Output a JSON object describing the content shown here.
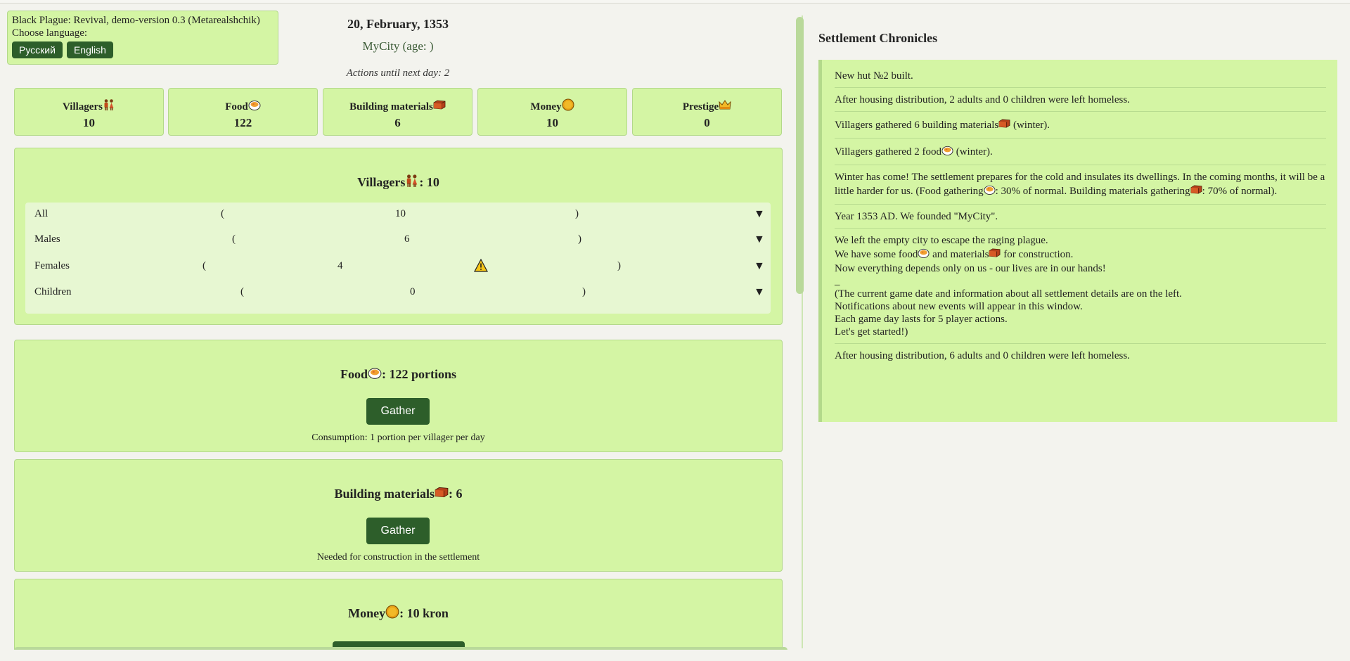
{
  "header": {
    "game_title": "Black Plague: Revival, demo-version 0.3 (Metarealshchik)",
    "choose_language": "Choose language:",
    "lang_ru": "Русский",
    "lang_en": "English",
    "date": "20, February, 1353",
    "city": "MyCity (age: )",
    "actions_until_next_day": "Actions until next day: 2"
  },
  "stats": [
    {
      "label": "Villagers",
      "icon": "villagers-icon",
      "value": "10"
    },
    {
      "label": "Food",
      "icon": "food-icon",
      "value": "122"
    },
    {
      "label": "Building materials",
      "icon": "bricks-icon",
      "value": "6"
    },
    {
      "label": "Money",
      "icon": "coin-icon",
      "value": "10"
    },
    {
      "label": "Prestige",
      "icon": "crown-icon",
      "value": "0"
    }
  ],
  "villagers_card": {
    "title": "Villagers",
    "title_value": ": 10",
    "rows": [
      {
        "label": "All",
        "open": "(",
        "value": "10",
        "close": ")",
        "arrow": "▼"
      },
      {
        "label": "Males",
        "open": "(",
        "value": "6",
        "close": ")",
        "arrow": "▼"
      },
      {
        "label": "Females",
        "open": "(",
        "value": "4",
        "close": ")",
        "arrow": "▼"
      },
      {
        "label": "Children",
        "open": "(",
        "value": "0",
        "close": ")",
        "arrow": "▼"
      }
    ]
  },
  "food_card": {
    "title": "Food",
    "title_value": ": 122 portions",
    "button": "Gather",
    "note": "Consumption: 1 portion per villager per day"
  },
  "materials_card": {
    "title": "Building materials",
    "title_value": ": 6",
    "button": "Gather",
    "note": "Needed for construction in the settlement"
  },
  "money_card": {
    "title": "Money",
    "title_value": ": 10 kron"
  },
  "chronicles": {
    "title": "Settlement Chronicles",
    "entries": [
      "New hut №2 built.",
      "After housing distribution, 2 adults and 0 children were left homeless.",
      "Villagers gathered 6 building materials{bricks} (winter).",
      "Villagers gathered 2 food{food} (winter).",
      "Winter has come! The settlement prepares for the cold and insulates its dwellings. In the coming months, it will be a little harder for us. (Food gathering{food}: 30% of normal. Building materials gathering{bricks}: 70% of normal).",
      "Year 1353 AD. We founded \"MyCity\".",
      "We left the empty city to escape the raging plague.\nWe have some food{food} and materials{bricks} for construction.\nNow everything depends only on us - our lives are in our hands!\n_\n(The current game date and information about all settlement details are on the left.\nNotifications about new events will appear in this window.\nEach game day lasts for 5 player actions.\nLet's get started!)",
      "After housing distribution, 6 adults and 0 children were left homeless."
    ]
  }
}
